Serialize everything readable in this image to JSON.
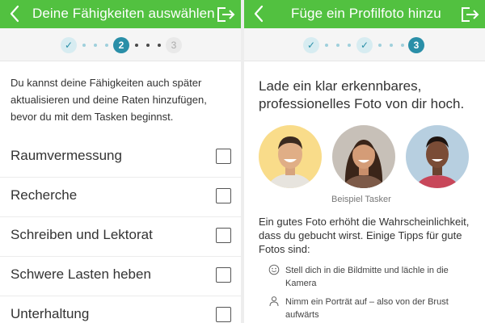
{
  "left_screen": {
    "title": "Deine Fähigkeiten auswählen",
    "stepper": {
      "done_mark": "✓",
      "active": "2",
      "todo": "3"
    },
    "intro": "Du kannst deine Fähigkeiten auch später aktualisieren und deine Raten hinzufügen, bevor du mit dem Tasken beginnst.",
    "skills": [
      {
        "label": "Raumvermessung",
        "checked": false
      },
      {
        "label": "Recherche",
        "checked": false
      },
      {
        "label": "Schreiben und Lektorat",
        "checked": false
      },
      {
        "label": "Schwere Lasten heben",
        "checked": false
      },
      {
        "label": "Unterhaltung",
        "checked": false
      }
    ]
  },
  "right_screen": {
    "title": "Füge ein Profilfoto hinzu",
    "stepper": {
      "done_mark_1": "✓",
      "done_mark_2": "✓",
      "active": "3"
    },
    "heading": "Lade ein klar erkennbares, professionelles Foto von dir hoch.",
    "caption": "Beispiel Tasker",
    "info": "Ein gutes Foto erhöht die Wahrscheinlichkeit, dass du gebucht wirst. Einige Tipps für gute Fotos sind:",
    "tips": [
      {
        "icon": "smile-icon",
        "text": "Stell dich in die Bildmitte und lächle in die Kamera"
      },
      {
        "icon": "person-icon",
        "text": "Nimm ein Porträt auf – also von der Brust aufwärts"
      }
    ]
  },
  "colors": {
    "header_green": "#52c140",
    "stepper_teal": "#2a8fa8",
    "avatar_bg_yellow": "#f9dc8a",
    "avatar_bg_gray": "#c7c0b8",
    "avatar_bg_blue": "#b7cfe0"
  }
}
